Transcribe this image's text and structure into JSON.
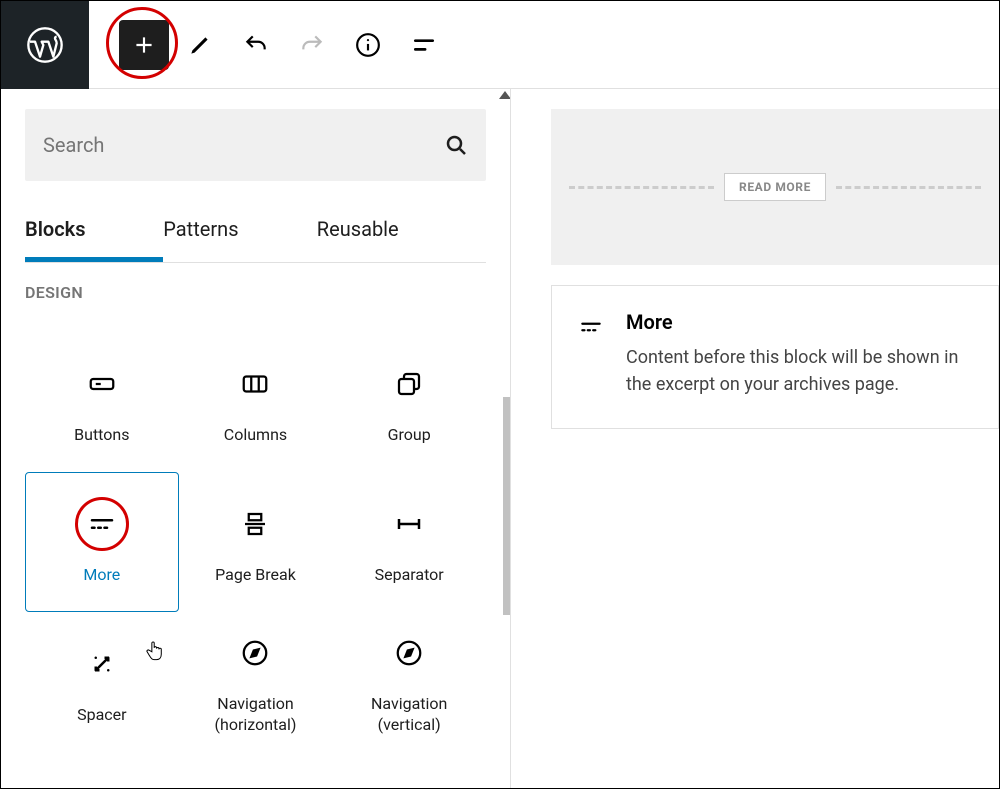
{
  "toolbar": {
    "logo_label": "WordPress",
    "add_label": "Add block",
    "edit_label": "Tools",
    "undo_label": "Undo",
    "redo_label": "Redo",
    "info_label": "Details",
    "outline_label": "Outline"
  },
  "inserter": {
    "search_placeholder": "Search",
    "tabs": {
      "blocks": "Blocks",
      "patterns": "Patterns",
      "reusable": "Reusable"
    },
    "category": "DESIGN",
    "blocks": [
      {
        "label": "Buttons"
      },
      {
        "label": "Columns"
      },
      {
        "label": "Group"
      },
      {
        "label": "More"
      },
      {
        "label": "Page Break"
      },
      {
        "label": "Separator"
      },
      {
        "label": "Spacer"
      },
      {
        "label": "Navigation (horizontal)"
      },
      {
        "label": "Navigation (vertical)"
      }
    ]
  },
  "preview": {
    "read_more": "READ MORE",
    "block_title": "More",
    "block_description": "Content before this block will be shown in the excerpt on your archives page."
  }
}
